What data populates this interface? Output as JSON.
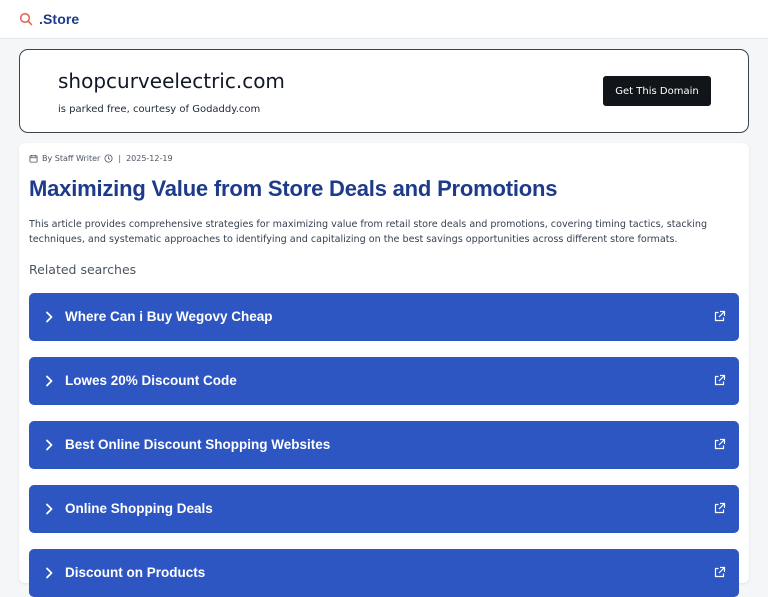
{
  "header": {
    "brand": ".Store",
    "logo_icon": "search-icon",
    "accent": "#e25d4a"
  },
  "domain_card": {
    "domain": "shopcurveelectric.com",
    "parked_text": "is parked free, courtesy of Godaddy.com",
    "cta_label": "Get This Domain"
  },
  "article": {
    "meta": {
      "author": "By Staff Writer",
      "date_sep": "|",
      "date": "2025-12-19",
      "calendar_icon": "calendar-icon",
      "clock_icon": "clock-icon"
    },
    "title": "Maximizing Value from Store Deals and Promotions",
    "summary": "This article provides comprehensive strategies for maximizing value from retail store deals and promotions, covering timing tactics, stacking techniques, and systematic approaches to identifying and capitalizing on the best savings opportunities across different store formats.",
    "related_heading": "Related searches",
    "related": [
      {
        "label": "Where Can i Buy Wegovy Cheap"
      },
      {
        "label": "Lowes 20% Discount Code"
      },
      {
        "label": "Best Online Discount Shopping Websites"
      },
      {
        "label": "Online Shopping Deals"
      },
      {
        "label": "Discount on Products"
      }
    ]
  },
  "colors": {
    "title": "#1e3a8a",
    "related_bg": "#2d56c2",
    "cta_bg": "#111418"
  }
}
